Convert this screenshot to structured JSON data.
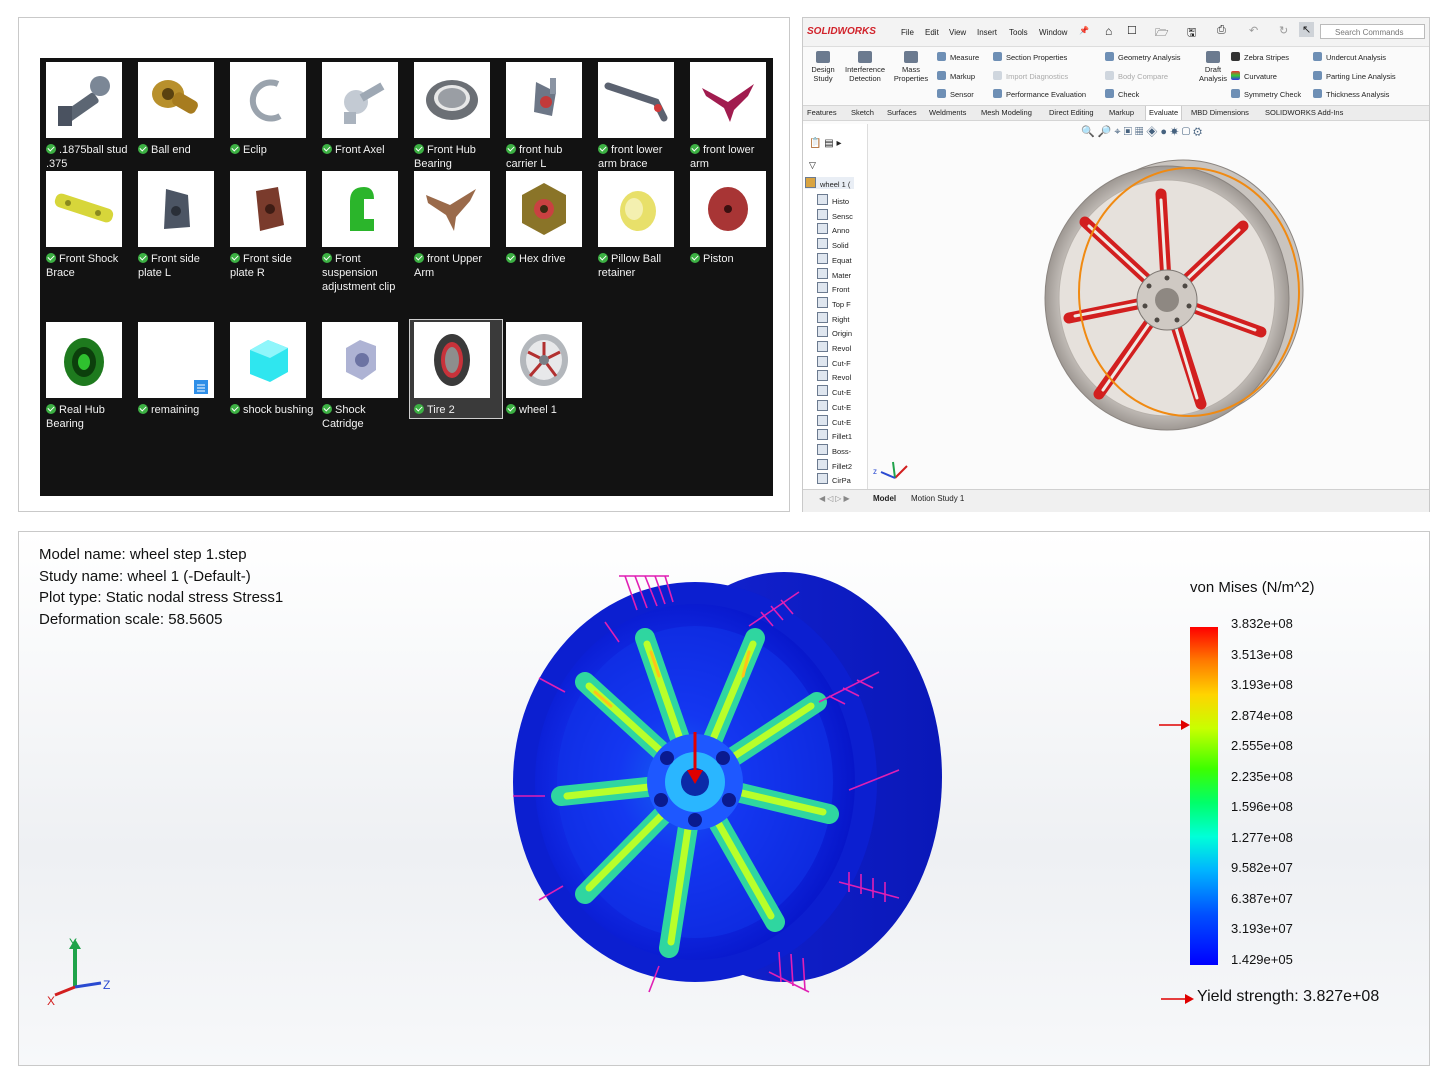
{
  "explorer": {
    "items": [
      {
        "label": ".1875ball stud .375"
      },
      {
        "label": "Ball end"
      },
      {
        "label": "Eclip"
      },
      {
        "label": "Front Axel"
      },
      {
        "label": "Front Hub Bearing"
      },
      {
        "label": "front hub carrier L"
      },
      {
        "label": "front lower arm brace"
      },
      {
        "label": "front lower arm"
      },
      {
        "label": "Front Shock Brace"
      },
      {
        "label": "Front side plate L"
      },
      {
        "label": "Front side plate R"
      },
      {
        "label": "Front suspension adjustment clip"
      },
      {
        "label": "front Upper Arm"
      },
      {
        "label": "Hex drive"
      },
      {
        "label": "Pillow Ball retainer"
      },
      {
        "label": "Piston"
      },
      {
        "label": "Real Hub Bearing"
      },
      {
        "label": "remaining"
      },
      {
        "label": "shock bushing"
      },
      {
        "label": "Shock Catridge"
      },
      {
        "label": "Tire 2"
      },
      {
        "label": "wheel 1"
      }
    ]
  },
  "solidworks": {
    "logo": "SOLIDWORKS",
    "menus": [
      "File",
      "Edit",
      "View",
      "Insert",
      "Tools",
      "Window"
    ],
    "search_placeholder": "Search Commands",
    "ribbon_big": [
      "Design Study",
      "Interference Detection",
      "Mass Properties",
      "Draft Analysis"
    ],
    "ribbon_small": [
      "Measure",
      "Markup",
      "Sensor",
      "Section Properties",
      "Import Diagnostics",
      "Performance Evaluation",
      "Geometry Analysis",
      "Body Compare",
      "Check",
      "Zebra Stripes",
      "Curvature",
      "Symmetry Check",
      "Undercut Analysis",
      "Parting Line Analysis",
      "Thickness Analysis"
    ],
    "cm_tabs": [
      "Features",
      "Sketch",
      "Surfaces",
      "Weldments",
      "Mesh Modeling",
      "Direct Editing",
      "Markup",
      "Evaluate",
      "MBD Dimensions",
      "SOLIDWORKS Add-Ins"
    ],
    "tree_root": "wheel 1 (",
    "tree_items": [
      "Histo",
      "Sensc",
      "Anno",
      "Solid",
      "Equat",
      "Mater",
      "Front",
      "Top F",
      "Right",
      "Origin",
      "Revol",
      "Cut-F",
      "Revol",
      "Cut-E",
      "Cut-E",
      "Cut-E",
      "Fillet1",
      "Boss-",
      "Fillet2",
      "CirPa"
    ],
    "bottom_tabs": [
      "Model",
      "Motion Study 1"
    ]
  },
  "simulation": {
    "model_name": "Model name: wheel step 1.step",
    "study_name": "Study name: wheel 1 (-Default-)",
    "plot_type": "Plot type: Static nodal stress Stress1",
    "deformation": "Deformation scale: 58.5605",
    "legend_title": "von Mises (N/m^2)",
    "legend_ticks": [
      "3.832e+08",
      "3.513e+08",
      "3.193e+08",
      "2.874e+08",
      "2.555e+08",
      "2.235e+08",
      "1.596e+08",
      "1.277e+08",
      "9.582e+07",
      "6.387e+07",
      "3.193e+07",
      "1.429e+05"
    ],
    "yield": "Yield strength: 3.827e+08",
    "axis_labels": {
      "x": "X",
      "y": "Y",
      "z": "Z"
    }
  },
  "colors": {
    "check_green": "#3cb043",
    "solidworks_red": "#d1222a",
    "arrow_red": "#e00000",
    "load_magenta": "#e01fb4"
  }
}
